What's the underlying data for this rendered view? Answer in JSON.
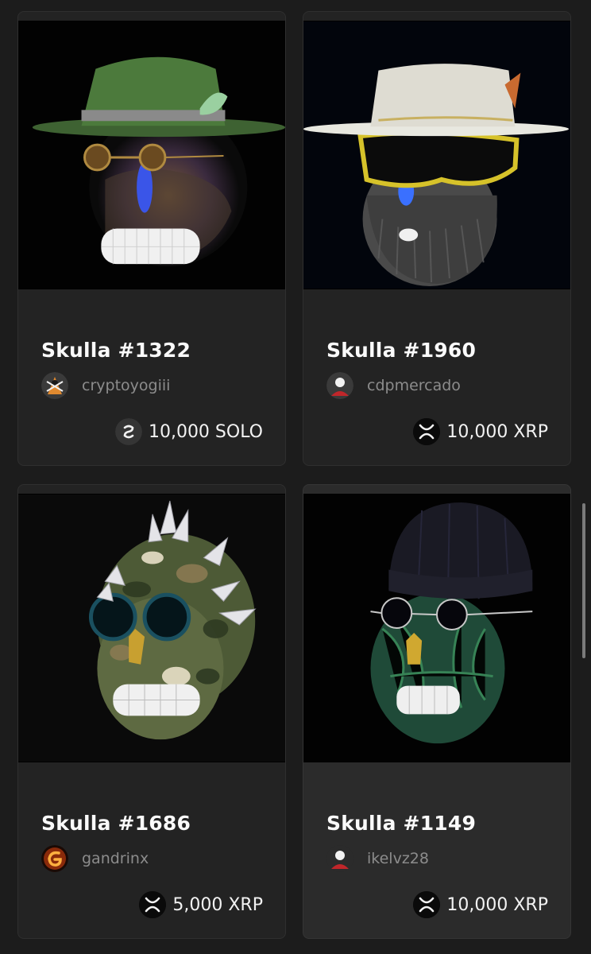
{
  "cards": [
    {
      "title": "Skulla #1322",
      "creator": "cryptoyogiii",
      "price": "10,000 SOLO",
      "currency_icon": "solo-coin-icon",
      "avatar": "cryptoyogiii-avatar"
    },
    {
      "title": "Skulla #1960",
      "creator": "cdpmercado",
      "price": "10,000 XRP",
      "currency_icon": "xrp-coin-icon",
      "avatar": "default-user-avatar"
    },
    {
      "title": "Skulla #1686",
      "creator": "gandrinx",
      "price": "5,000 XRP",
      "currency_icon": "xrp-coin-icon",
      "avatar": "gandrinx-flame-avatar"
    },
    {
      "title": "Skulla #1149",
      "creator": "ikelvz28",
      "price": "10,000 XRP",
      "currency_icon": "xrp-coin-icon",
      "avatar": "default-user-avatar"
    }
  ],
  "colors": {
    "background": "#1c1c1c",
    "card": "#232323",
    "card_hover": "#2b2b2b",
    "muted_text": "#8c8c8c"
  }
}
